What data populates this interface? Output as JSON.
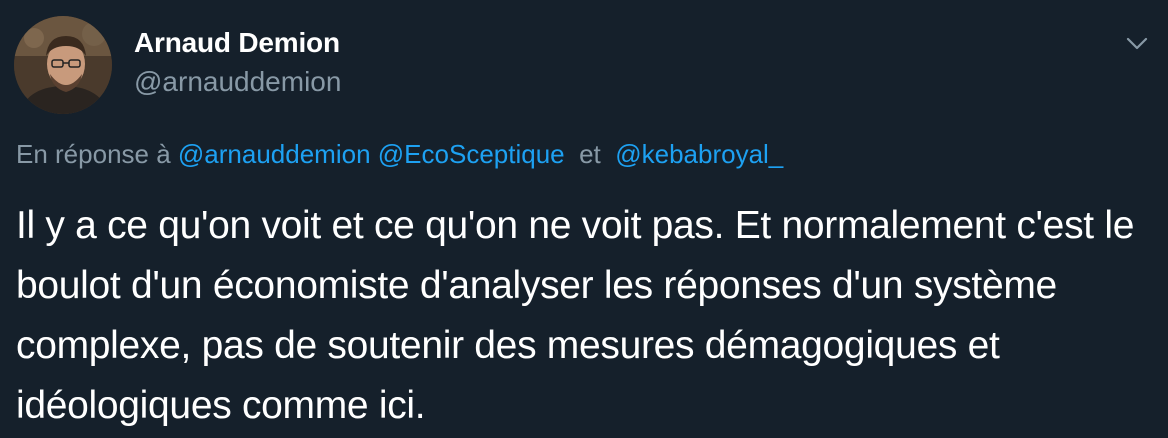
{
  "tweet": {
    "author_name": "Arnaud Demion",
    "author_handle": "@arnauddemion",
    "reply_prefix": "En réponse à",
    "reply_mentions": [
      "@arnauddemion",
      "@EcoSceptique",
      "@kebabroyal_"
    ],
    "reply_connector": "et",
    "text": "Il y a ce qu'on voit et ce qu'on ne voit pas. Et normalement c'est le boulot d'un économiste d'analyser les réponses d'un système complexe, pas de soutenir des mesures démagogiques et idéologiques comme ici."
  },
  "icons": {
    "avatar": "user-avatar",
    "menu": "chevron-down-icon"
  },
  "colors": {
    "background": "#15202b",
    "text": "#ffffff",
    "secondary": "#8899a6",
    "link": "#1da1f2"
  }
}
